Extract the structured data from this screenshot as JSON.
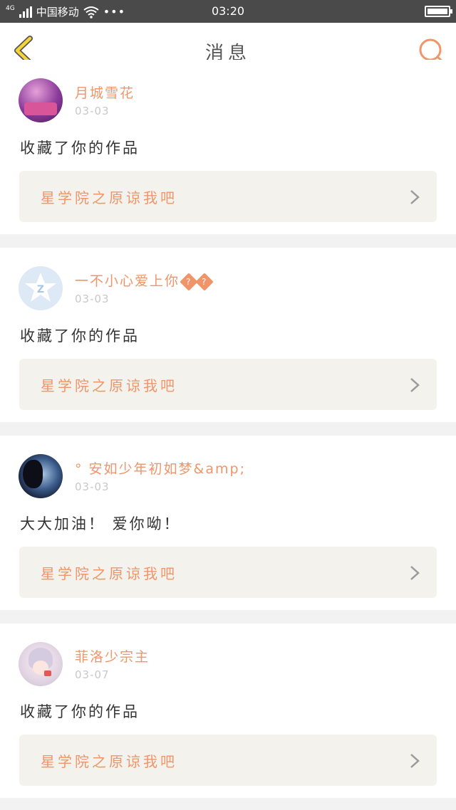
{
  "status_bar": {
    "network_type": "4G",
    "carrier": "中国移动",
    "more": "•••",
    "time": "03:20"
  },
  "header": {
    "title": "消息"
  },
  "messages": [
    {
      "username": "月城雪花",
      "date": "03-03",
      "text": "收藏了你的作品",
      "work_title": "星学院之原谅我吧"
    },
    {
      "username": "一不小心爱上你",
      "username_suffix": [
        "?",
        "?"
      ],
      "date": "03-03",
      "text": "收藏了你的作品",
      "work_title": "星学院之原谅我吧"
    },
    {
      "username": "° 安如少年初如梦&amp;",
      "date": "03-03",
      "text": "大大加油！ 爱你呦！",
      "work_title": "星学院之原谅我吧"
    },
    {
      "username": "菲洛少宗主",
      "date": "03-07",
      "text": "收藏了你的作品",
      "work_title": "星学院之原谅我吧"
    }
  ],
  "icons": {
    "back": "back-arrow-icon",
    "search": "search-icon",
    "chevron": "chevron-right-icon"
  },
  "colors": {
    "accent": "#f0956a",
    "back_icon": "#f5d33a",
    "status_bar": "#4a4a4a",
    "card_link_bg": "#f3f2ec"
  }
}
